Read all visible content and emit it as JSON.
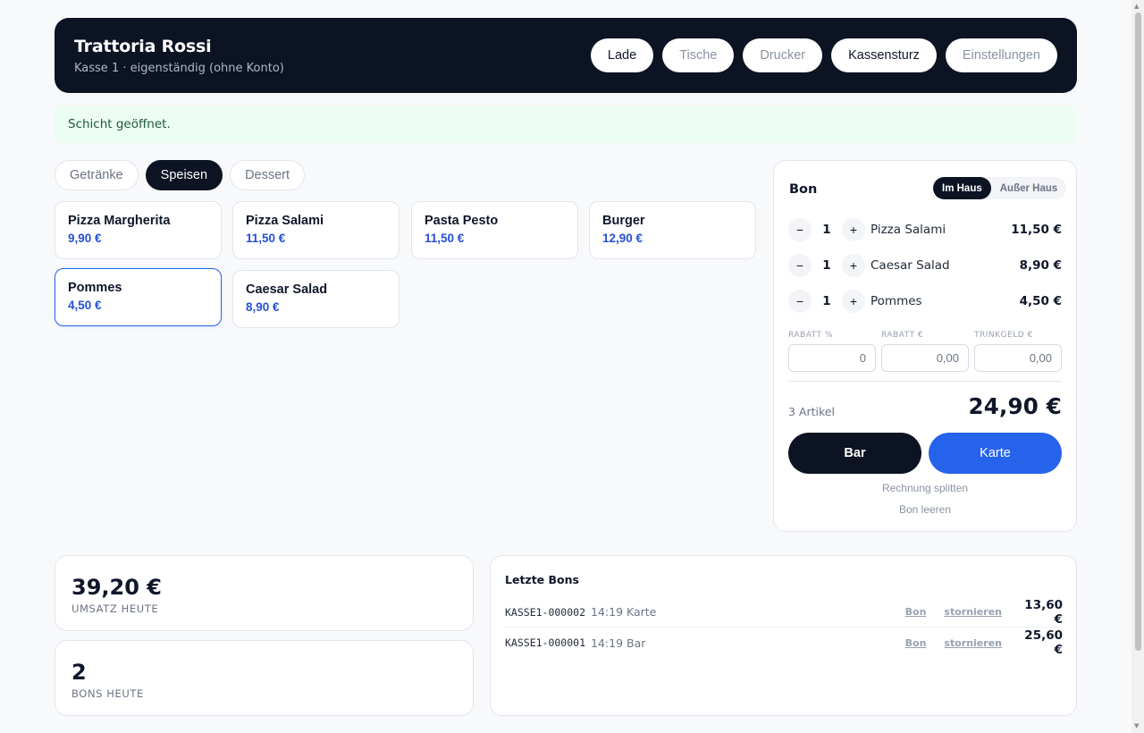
{
  "header": {
    "title": "Trattoria Rossi",
    "subtitle": "Kasse 1 · eigenständig (ohne Konto)",
    "nav": [
      {
        "label": "Lade"
      },
      {
        "label": "Tische"
      },
      {
        "label": "Drucker"
      },
      {
        "label": "Kassensturz"
      },
      {
        "label": "Einstellungen"
      }
    ]
  },
  "alert": {
    "text": "Schicht geöffnet."
  },
  "categories": [
    {
      "label": "Getränke",
      "active": false
    },
    {
      "label": "Speisen",
      "active": true
    },
    {
      "label": "Dessert",
      "active": false
    }
  ],
  "products": [
    {
      "name": "Pizza Margherita",
      "price": "9,90 €"
    },
    {
      "name": "Pizza Salami",
      "price": "11,50 €"
    },
    {
      "name": "Pasta Pesto",
      "price": "11,50 €"
    },
    {
      "name": "Burger",
      "price": "12,90 €"
    },
    {
      "name": "Pommes",
      "price": "4,50 €"
    },
    {
      "name": "Caesar Salad",
      "price": "8,90 €"
    }
  ],
  "bon": {
    "title": "Bon",
    "mode_in": "Im Haus",
    "mode_out": "Außer Haus",
    "minus": "−",
    "plus": "+",
    "lines": [
      {
        "qty": "1",
        "name": "Pizza Salami",
        "price": "11,50 €"
      },
      {
        "qty": "1",
        "name": "Caesar Salad",
        "price": "8,90 €"
      },
      {
        "qty": "1",
        "name": "Pommes",
        "price": "4,50 €"
      }
    ],
    "discount_pct_label": "RABATT %",
    "discount_pct_value": "0",
    "discount_eur_label": "RABATT €",
    "discount_eur_value": "0,00",
    "tip_label": "TRINKGELD €",
    "tip_value": "0,00",
    "item_count": "3 Artikel",
    "total": "24,90 €",
    "pay_cash": "Bar",
    "pay_card": "Karte",
    "split": "Rechnung splitten",
    "clear": "Bon leeren"
  },
  "stats": {
    "revenue_value": "39,20 €",
    "revenue_label": "UMSATZ HEUTE",
    "count_value": "2",
    "count_label": "BONS HEUTE"
  },
  "recent": {
    "title": "Letzte Bons",
    "link_bon": "Bon",
    "link_cancel": "stornieren",
    "rows": [
      {
        "id": "KASSE1-000002",
        "time": "14:19",
        "method": "Karte",
        "amount": "13,60 €"
      },
      {
        "id": "KASSE1-000001",
        "time": "14:19",
        "method": "Bar",
        "amount": "25,60 €"
      }
    ]
  },
  "colors": {
    "header_bg": "#0c1322",
    "accent": "#2563eb",
    "price": "#2451d6",
    "alert_bg": "#ecfdf3"
  }
}
